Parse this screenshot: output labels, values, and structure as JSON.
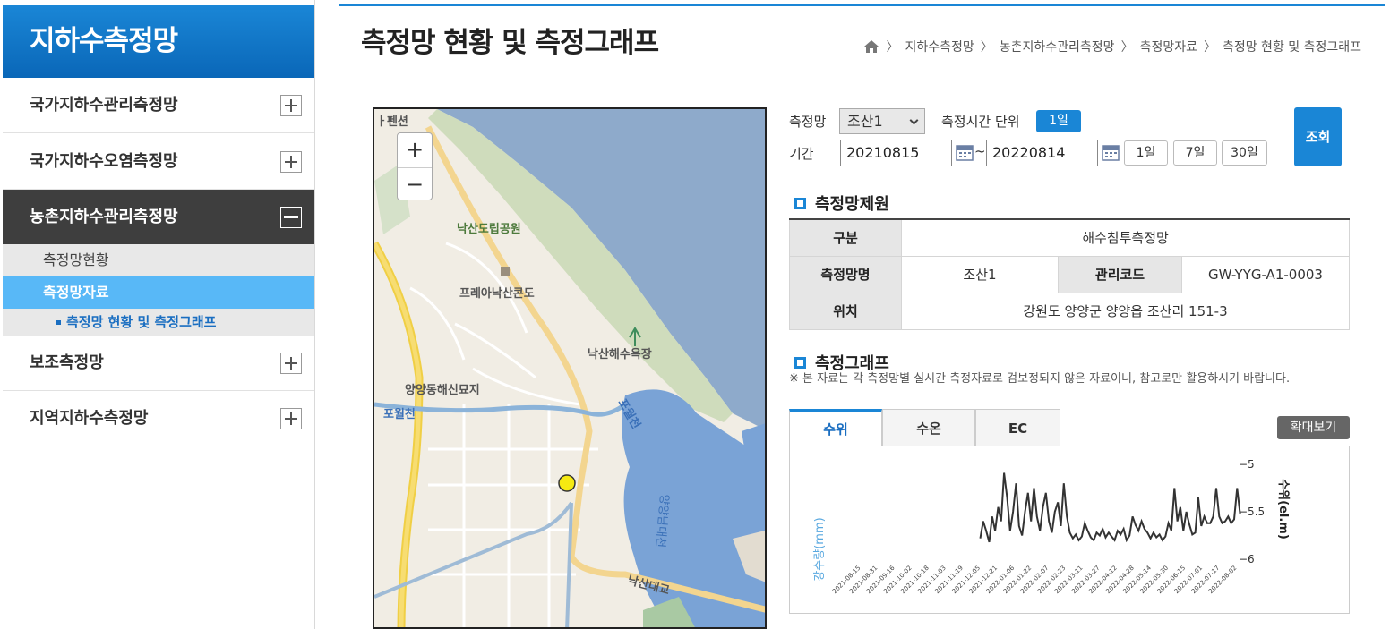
{
  "sidebar": {
    "title": "지하수측정망",
    "menu": [
      {
        "label": "국가지하수관리측정망"
      },
      {
        "label": "국가지하수오염측정망"
      },
      {
        "label": "농촌지하수관리측정망"
      },
      {
        "label": "보조측정망"
      },
      {
        "label": "지역지하수측정망"
      }
    ],
    "sub_items": [
      {
        "label": "측정망현황"
      },
      {
        "label": "측정망자료"
      }
    ],
    "subsub_label": "측정망 현황 및 측정그래프"
  },
  "header": {
    "title": "측정망 현황 및 측정그래프",
    "breadcrumb": [
      "지하수측정망",
      "농촌지하수관리측정망",
      "측정망자료",
      "측정망 현황 및 측정그래프"
    ]
  },
  "map": {
    "labels": {
      "pension": "ㅏ펜션",
      "park": "낙산도립공원",
      "condo": "프레아낙산콘도",
      "beach": "낙산해수욕장",
      "cemetery": "양양동해신묘지",
      "stream1": "포월천",
      "stream2": "포월천",
      "river": "양양남대천",
      "bridge": "낙산대교"
    },
    "zoom_in": "+",
    "zoom_out": "−"
  },
  "controls": {
    "station_label": "측정망",
    "station_value": "조산1",
    "unit_label": "측정시간 단위",
    "unit_value": "1일",
    "period_label": "기간",
    "start_date": "20210815",
    "end_date": "20220814",
    "tilde": "~",
    "quick": [
      "1일",
      "7일",
      "30일"
    ],
    "search": "조회"
  },
  "info": {
    "heading": "측정망제원",
    "rows": {
      "category_label": "구분",
      "category_value": "해수침투측정망",
      "name_label": "측정망명",
      "name_value": "조산1",
      "code_label": "관리코드",
      "code_value": "GW-YYG-A1-0003",
      "location_label": "위치",
      "location_value": "강원도 양양군 양양읍 조산리 151-3"
    }
  },
  "graph": {
    "heading": "측정그래프",
    "note": "※ 본 자료는 각 측정망별 실시간 측정자료로 검보정되지 않은 자료이니, 참고로만 활용하시기 바랍니다.",
    "tabs": [
      "수위",
      "수온",
      "EC"
    ],
    "zoom_view": "확대보기"
  },
  "colors": {
    "accent": "#1a86d6",
    "sidebar_active": "#3e3e3e",
    "sub_selected": "#58b8f7",
    "rain_axis": "#5aa9e0",
    "line": "#333333"
  },
  "chart_data": {
    "type": "line",
    "left_axis_label": "강수량(mm)",
    "right_axis_label": "수위(el.m)",
    "ylim_right": [
      -6,
      -5
    ],
    "yticks_right": [
      "-5",
      "-5.5",
      "-6"
    ],
    "x_ticks": [
      "2021-08-15",
      "2021-08-31",
      "2021-09-16",
      "2021-10-02",
      "2021-10-18",
      "2021-11-03",
      "2021-11-19",
      "2021-12-05",
      "2021-12-21",
      "2022-01-06",
      "2022-01-22",
      "2022-02-07",
      "2022-02-23",
      "2022-03-11",
      "2022-03-27",
      "2022-04-12",
      "2022-04-28",
      "2022-05-14",
      "2022-05-30",
      "2022-06-15",
      "2022-07-01",
      "2022-07-17",
      "2022-08-02"
    ],
    "series": [
      {
        "name": "수위(el.m)",
        "x_start_index": 7.2,
        "x_end_index": 22.4,
        "values": [
          -5.78,
          -5.6,
          -5.7,
          -5.82,
          -5.55,
          -5.7,
          -5.45,
          -5.6,
          -5.09,
          -5.35,
          -5.7,
          -5.5,
          -5.2,
          -5.65,
          -5.75,
          -5.5,
          -5.3,
          -5.6,
          -5.25,
          -5.55,
          -5.7,
          -5.45,
          -5.3,
          -5.6,
          -5.72,
          -5.5,
          -5.4,
          -5.65,
          -5.2,
          -5.55,
          -5.72,
          -5.78,
          -5.74,
          -5.8,
          -5.76,
          -5.62,
          -5.7,
          -5.77,
          -5.8,
          -5.72,
          -5.75,
          -5.68,
          -5.77,
          -5.72,
          -5.76,
          -5.8,
          -5.7,
          -5.74,
          -5.68,
          -5.8,
          -5.75,
          -5.55,
          -5.64,
          -5.7,
          -5.6,
          -5.68,
          -5.72,
          -5.78,
          -5.72,
          -5.77,
          -5.74,
          -5.8,
          -5.76,
          -5.62,
          -5.7,
          -5.25,
          -5.6,
          -5.45,
          -5.7,
          -5.5,
          -5.63,
          -5.74,
          -5.72,
          -5.35,
          -5.65,
          -5.55,
          -5.62,
          -5.62,
          -5.55,
          -5.25,
          -5.55,
          -5.62,
          -5.6,
          -5.55,
          -5.62,
          -5.58,
          -5.25,
          -5.52
        ]
      }
    ]
  }
}
